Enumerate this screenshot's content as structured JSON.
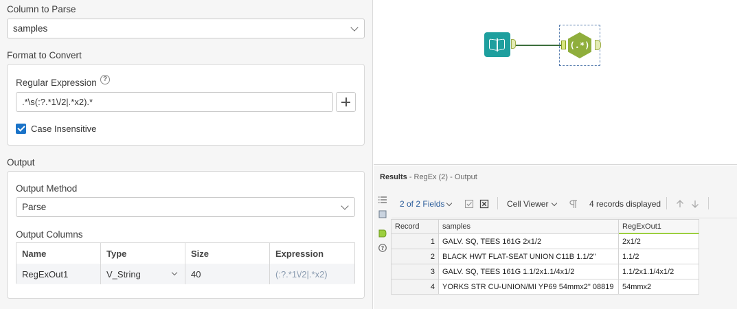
{
  "config": {
    "column_to_parse": {
      "label": "Column to Parse",
      "value": "samples"
    },
    "format_to_convert": {
      "label": "Format to Convert",
      "regex_label": "Regular Expression",
      "regex_value": ".*\\s(:?.*1\\/2|.*x2).*",
      "case_insensitive_label": "Case Insensitive",
      "case_insensitive": true
    },
    "output": {
      "label": "Output",
      "method_label": "Output Method",
      "method_value": "Parse",
      "columns_label": "Output Columns",
      "columns_headers": [
        "Name",
        "Type",
        "Size",
        "Expression"
      ],
      "columns_rows": [
        {
          "name": "RegExOut1",
          "type": "V_String",
          "size": "40",
          "expression": "(:?.*1\\/2|.*x2)"
        }
      ]
    }
  },
  "canvas": {
    "input_tool_icon": "book-icon",
    "regex_tool_label": "(.*)",
    "colors": {
      "input_tool": "#1e9f9e",
      "regex_tool": "#8fae3c",
      "connection": "#3c6e3c"
    }
  },
  "results": {
    "title": "Results",
    "subtitle": "- RegEx (2) - Output",
    "fields_label": "2 of 2 Fields",
    "cell_viewer_label": "Cell Viewer",
    "records_label": "4 records displayed",
    "headers": [
      "Record",
      "samples",
      "RegExOut1"
    ],
    "rows": [
      {
        "record": "1",
        "samples": "GALV. SQ, TEES 161G 2x1/2",
        "out": "2x1/2"
      },
      {
        "record": "2",
        "samples": "BLACK HWT FLAT-SEAT UNION C11B 1.1/2\"",
        "out": "1.1/2"
      },
      {
        "record": "3",
        "samples": "GALV. SQ, TEES 161G 1.1/2x1.1/4x1/2",
        "out": "1.1/2x1.1/4x1/2"
      },
      {
        "record": "4",
        "samples": "YORKS STR CU-UNION/MI YP69 54mmx2\" 08819",
        "out": "54mmx2"
      }
    ]
  }
}
